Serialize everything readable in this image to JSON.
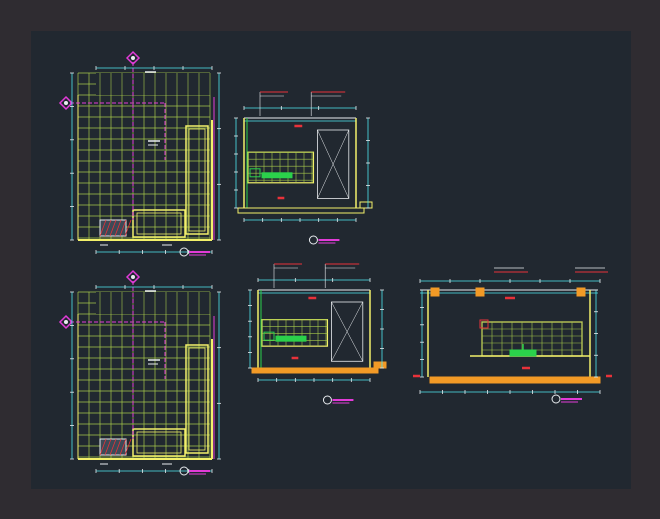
{
  "colors": {
    "frame": "#2f2c31",
    "canvas": "#212830",
    "grid": "#a7c94a",
    "wall": "#f3f06a",
    "dim": "#4fe7ef",
    "magenta": "#e23bd8",
    "red": "#e8323a",
    "orange": "#f29a26",
    "green": "#2bd14b",
    "white": "#e9ecef"
  },
  "drawings": [
    {
      "kind": "floor-plan",
      "tag": "1"
    },
    {
      "kind": "section",
      "tag": "2"
    },
    {
      "kind": "floor-plan",
      "tag": "3"
    },
    {
      "kind": "section",
      "tag": "4"
    },
    {
      "kind": "section",
      "tag": "5"
    }
  ]
}
